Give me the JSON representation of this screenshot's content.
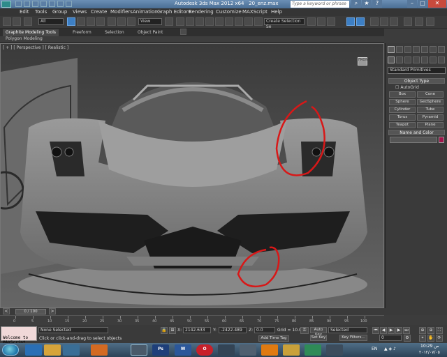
{
  "title": {
    "app": "Autodesk 3ds Max 2012 x64",
    "file": "20_enz.max",
    "search_placeholder": "Type a keyword or phrase"
  },
  "menu": [
    "Edit",
    "Tools",
    "Group",
    "Views",
    "Create",
    "Modifiers",
    "Animation",
    "Graph Editors",
    "Rendering",
    "Customize",
    "MAXScript",
    "Help"
  ],
  "toolbar": {
    "filter_value": "All",
    "refcoord_value": "View",
    "selection_set_placeholder": "Create Selection Se"
  },
  "ribbon": {
    "tabs": [
      "Graphite Modeling Tools",
      "Freeform",
      "Selection",
      "Object Paint"
    ],
    "sub_label": "Polygon Modeling"
  },
  "viewport": {
    "label": "[ + ] [ Perspective ] [ Realistic ]",
    "cube_label": "FRONT"
  },
  "command_panel": {
    "category": "Standard Primitives",
    "object_type_header": "Object Type",
    "autogrid_label": "AutoGrid",
    "buttons": [
      "Box",
      "Cone",
      "Sphere",
      "GeoSphere",
      "Cylinder",
      "Tube",
      "Torus",
      "Pyramid",
      "Teapot",
      "Plane"
    ],
    "name_color_header": "Name and Color"
  },
  "timeline": {
    "slider_label": "0 / 100",
    "ticks": [
      "0",
      "5",
      "10",
      "15",
      "20",
      "25",
      "30",
      "35",
      "40",
      "45",
      "50",
      "55",
      "60",
      "65",
      "70",
      "75",
      "80",
      "85",
      "90",
      "95",
      "100"
    ]
  },
  "status": {
    "maxscript_text": "Welcome to MAXScript",
    "selection": "None Selected",
    "prompt": "Click or click-and-drag to select objects",
    "x_label": "X:",
    "x_value": "2142.633",
    "y_label": "Y:",
    "y_value": "-2422.489",
    "z_label": "Z:",
    "z_value": "0.0",
    "grid": "Grid = 10.0",
    "add_time_tag": "Add Time Tag",
    "auto_key": "Auto Key",
    "set_key": "Set Key",
    "key_mode_value": "Selected",
    "key_filters": "Key Filters...",
    "frame_value": "0"
  },
  "taskbar": {
    "apps": [
      "IE",
      "Explorer",
      "Media",
      "Firefox",
      "3ds Max",
      "Photoshop",
      "Word",
      "Opera",
      "Clock",
      "Ring",
      "VLC",
      "Folder",
      "Messenger",
      "Tool"
    ]
  },
  "tray": {
    "lang": "EN",
    "time": "10:29 ص",
    "date": "٢٠١٢/٠٧/٠٥"
  },
  "colors": {
    "annotation": "#d81818",
    "accent": "#3d7fc4",
    "swatch": "#a0144a"
  }
}
